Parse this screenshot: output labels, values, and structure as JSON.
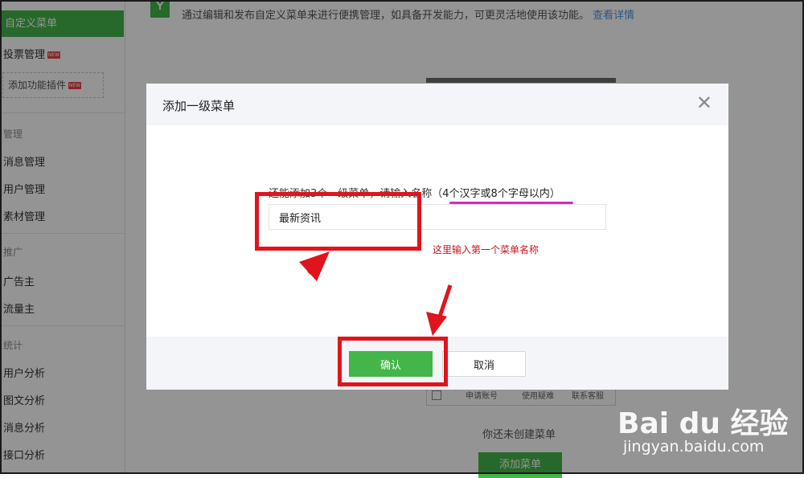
{
  "sidebar": {
    "active_item": "自定义菜单",
    "vote_item": "投票管理",
    "new_badge": "NEW",
    "add_plugin": "添加功能插件",
    "groups": [
      {
        "title": "管理",
        "items": [
          "消息管理",
          "用户管理",
          "素材管理"
        ]
      },
      {
        "title": "推广",
        "items": [
          "广告主",
          "流量主"
        ]
      },
      {
        "title": "统计",
        "items": [
          "用户分析",
          "图文分析",
          "消息分析",
          "接口分析"
        ]
      }
    ]
  },
  "main": {
    "notice_text": "通过编辑和发布自定义菜单来进行便携管理，如具备开发能力，可更灵活地使用该功能。",
    "notice_link": "查看详情",
    "empty_tip": "你还未创建菜单",
    "add_menu_button": "添加菜单",
    "phone_tabs": [
      "申请账号",
      "使用疑难",
      "联系客服"
    ]
  },
  "dialog": {
    "title": "添加一级菜单",
    "hint_prefix": "还能添加3个一级菜单，请输入名称（",
    "hint_limit": "4个汉字或8个字母以内",
    "hint_suffix": "）",
    "input_value": "最新资讯",
    "annotation_note": "这里输入第一个菜单名称",
    "confirm_label": "确认",
    "cancel_label": "取消"
  },
  "watermark": {
    "logo_text": "Bai du 经验",
    "url": "jingyan.baidu.com"
  },
  "colors": {
    "accent": "#44b549",
    "annotation_red": "#e0141d",
    "underline_pink": "#d62ac6"
  }
}
